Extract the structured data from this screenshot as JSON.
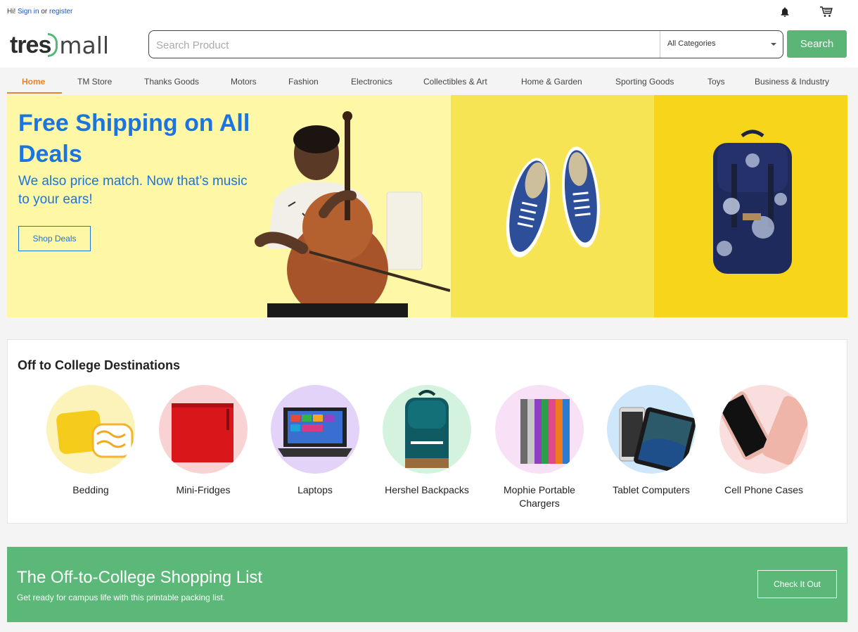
{
  "topbar": {
    "greeting_prefix": "Hi! ",
    "sign_in": "Sign in",
    "or": " or ",
    "register": "register",
    "icons": [
      "bell-icon",
      "cart-icon"
    ]
  },
  "header": {
    "logo_part1": "tres",
    "logo_part2": "mall",
    "search_placeholder": "Search Product",
    "search_value": "",
    "category_selected": "All Categories",
    "search_button": "Search"
  },
  "nav": {
    "items": [
      {
        "label": "Home",
        "active": true
      },
      {
        "label": "TM Store"
      },
      {
        "label": "Thanks Goods"
      },
      {
        "label": "Motors"
      },
      {
        "label": "Fashion"
      },
      {
        "label": "Electronics"
      },
      {
        "label": "Collectibles & Art"
      },
      {
        "label": "Home & Garden"
      },
      {
        "label": "Sporting Goods"
      },
      {
        "label": "Toys"
      },
      {
        "label": "Business & Industry"
      }
    ]
  },
  "hero": {
    "title": "Free Shipping on All Deals",
    "subtitle": "We also price match. Now that’s music to your ears!",
    "button": "Shop Deals"
  },
  "college": {
    "title": "Off to College Destinations",
    "categories": [
      {
        "label": "Bedding",
        "bg": "#fbf3b9"
      },
      {
        "label": "Mini-Fridges",
        "bg": "#f9d3d3"
      },
      {
        "label": "Laptops",
        "bg": "#e3d3f8"
      },
      {
        "label": "Hershel Backpacks",
        "bg": "#d4f3df"
      },
      {
        "label": "Mophie Portable Chargers",
        "bg": "#f8e1f6"
      },
      {
        "label": "Tablet Computers",
        "bg": "#cfe7fb"
      },
      {
        "label": "Cell Phone Cases",
        "bg": "#f9dedd"
      }
    ]
  },
  "banner": {
    "title": "The Off-to-College Shopping List",
    "subtitle": "Get ready for campus life with this printable packing list.",
    "button": "Check It Out"
  },
  "colors": {
    "brand_green": "#5bb577",
    "accent_orange": "#e9842f",
    "hero_blue": "#1c74e0"
  }
}
